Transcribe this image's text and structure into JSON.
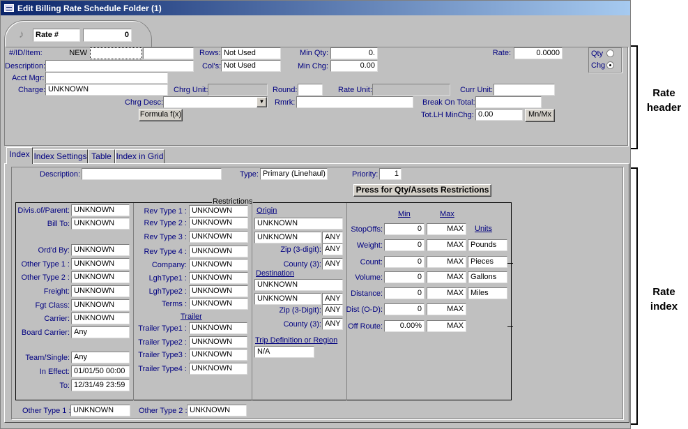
{
  "window": {
    "title": "Edit Billing Rate Schedule Folder (1)"
  },
  "rate_tab": {
    "label": "Rate #",
    "value": "0"
  },
  "header": {
    "id_label": "#/ID/Item:",
    "id_value": "NEW",
    "id_field2": "",
    "id_field3": "",
    "rows_label": "Rows:",
    "rows_value": "Not Used",
    "minqty_label": "Min Qty:",
    "minqty_value": "0.",
    "rate_label": "Rate:",
    "rate_value": "0.0000",
    "qty_label": "Qty",
    "chg_label": "Chg",
    "selected_mode": "Chg",
    "desc_label": "Description:",
    "desc_value": "",
    "cols_label": "Col's:",
    "cols_value": "Not Used",
    "minchg_label": "Min Chg:",
    "minchg_value": "0.00",
    "acctmgr_label": "Acct Mgr:",
    "acctmgr_value": "",
    "charge_label": "Charge:",
    "charge_value": "UNKNOWN",
    "chrgunit_label": "Chrg Unit:",
    "chrgunit_value": "",
    "round_label": "Round:",
    "round_value": "",
    "rateunit_label": "Rate Unit:",
    "rateunit_value": "",
    "currunit_label": "Curr Unit:",
    "currunit_value": "",
    "chrgdesc_label": "Chrg Desc:",
    "chrgdesc_value": "",
    "rmrk_label": "Rmrk:",
    "rmrk_value": "",
    "breakon_label": "Break On Total:",
    "breakon_value": "",
    "formula_button": "Formula f(x)",
    "totlh_label": "Tot.LH MinChg:",
    "totlh_value": "0.00",
    "mnmx_button": "Mn/Mx"
  },
  "tabs": [
    "Index",
    "Index Settings",
    "Table",
    "Index in Grid"
  ],
  "index": {
    "desc_label": "Description:",
    "desc_value": "",
    "type_label": "Type:",
    "type_value": "Primary (Linehaul)",
    "priority_label": "Priority:",
    "priority_value": "1",
    "qty_button": "Press for Qty/Assets Restrictions",
    "restrictions_label": "Restrictions",
    "col1": [
      {
        "label": "Divis.of/Parent:",
        "value": "UNKNOWN"
      },
      {
        "label": "Bill To:",
        "value": "UNKNOWN"
      },
      {
        "label": "Ord'd By:",
        "value": "UNKNOWN"
      },
      {
        "label": "Other Type 1 :",
        "value": "UNKNOWN"
      },
      {
        "label": "Other Type 2 :",
        "value": "UNKNOWN"
      },
      {
        "label": "Freight:",
        "value": "UNKNOWN"
      },
      {
        "label": "Fgt Class:",
        "value": "UNKNOWN"
      },
      {
        "label": "Carrier:",
        "value": "UNKNOWN"
      },
      {
        "label": "Board Carrier:",
        "value": "Any"
      },
      {
        "label": "Team/Single:",
        "value": "Any"
      },
      {
        "label": "In Effect:",
        "value": "01/01/50 00:00"
      },
      {
        "label": "To:",
        "value": "12/31/49 23:59"
      }
    ],
    "col2": [
      {
        "label": "Rev Type 1 :",
        "value": "UNKNOWN"
      },
      {
        "label": "Rev Type 2 :",
        "value": "UNKNOWN"
      },
      {
        "label": "Rev Type 3 :",
        "value": "UNKNOWN"
      },
      {
        "label": "Rev Type 4 :",
        "value": "UNKNOWN"
      },
      {
        "label": "Company:",
        "value": "UNKNOWN"
      },
      {
        "label": "LghType1 :",
        "value": "UNKNOWN"
      },
      {
        "label": "LghType2 :",
        "value": "UNKNOWN"
      },
      {
        "label": "Terms :",
        "value": "UNKNOWN"
      }
    ],
    "trailer_label": "Trailer",
    "trailers": [
      {
        "label": "Trailer Type1 :",
        "value": "UNKNOWN"
      },
      {
        "label": "Trailer Type2 :",
        "value": "UNKNOWN"
      },
      {
        "label": "Trailer Type3 :",
        "value": "UNKNOWN"
      },
      {
        "label": "Trailer Type4 :",
        "value": "UNKNOWN"
      }
    ],
    "origin": {
      "label": "Origin",
      "value1": "UNKNOWN",
      "value2": "UNKNOWN",
      "value2_any": "ANY",
      "zip_label": "Zip (3-digit):",
      "zip_value": "ANY",
      "county_label": "County (3):",
      "county_value": "ANY"
    },
    "destination": {
      "label": "Destination",
      "value1": "UNKNOWN",
      "value2": "UNKNOWN",
      "value2_any": "ANY",
      "zip_label": "Zip (3-Digit):",
      "zip_value": "ANY",
      "county_label": "County (3):",
      "county_value": "ANY"
    },
    "trip_label": "Trip Definition or Region",
    "trip_value": "N/A",
    "minmax": {
      "min_header": "Min",
      "max_header": "Max",
      "units_header": "Units",
      "rows": [
        {
          "label": "StopOffs:",
          "min": "0",
          "max": "MAX",
          "unit": ""
        },
        {
          "label": "Weight:",
          "min": "0",
          "max": "MAX",
          "unit": "Pounds"
        },
        {
          "label": "Count:",
          "min": "0",
          "max": "MAX",
          "unit": "Pieces"
        },
        {
          "label": "Volume:",
          "min": "0",
          "max": "MAX",
          "unit": "Gallons"
        },
        {
          "label": "Distance:",
          "min": "0",
          "max": "MAX",
          "unit": "Miles"
        },
        {
          "label": "Dist (O-D):",
          "min": "0",
          "max": "MAX",
          "unit": ""
        },
        {
          "label": "Off Route:",
          "min": "0.00%",
          "max": "MAX",
          "unit": ""
        }
      ]
    },
    "bottom": {
      "ot1_label": "Other Type 1 :",
      "ot1_value": "UNKNOWN",
      "ot2_label": "Other Type 2 :",
      "ot2_value": "UNKNOWN"
    }
  },
  "annotations": {
    "rate_header": "Rate header",
    "rate_index": "Rate index"
  }
}
